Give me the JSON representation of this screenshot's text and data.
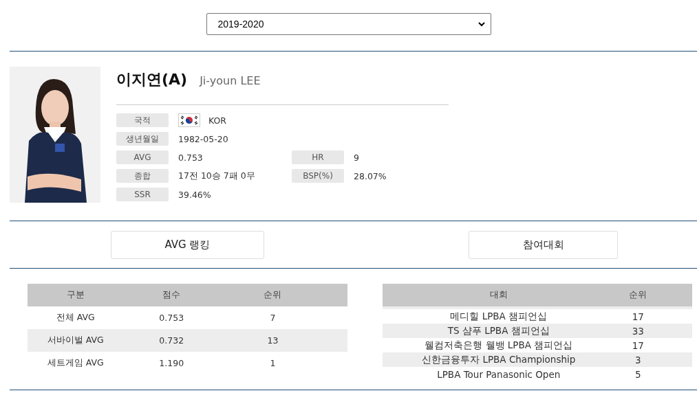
{
  "season_select": {
    "value": "2019-2020"
  },
  "player": {
    "name_ko": "이지연(A)",
    "name_en": "Ji-youn LEE",
    "info_rows": [
      {
        "label": "국적",
        "value": "KOR",
        "kind": "flag"
      },
      {
        "label": "생년월일",
        "value": "1982-05-20",
        "kind": "text"
      },
      {
        "label": "AVG",
        "value": "0.753",
        "label2": "HR",
        "value2": "9",
        "kind": "text"
      },
      {
        "label": "종합",
        "value": "17전 10승 7패 0무",
        "label2": "BSP(%)",
        "value2": "28.07%",
        "kind": "text"
      },
      {
        "label": "SSR",
        "value": "39.46%",
        "kind": "text"
      }
    ]
  },
  "buttons": [
    {
      "label": "AVG 랭킹"
    },
    {
      "label": "참여대회"
    }
  ],
  "avg_table": {
    "columns": [
      "구분",
      "점수",
      "순위"
    ],
    "rows": [
      [
        "전체 AVG",
        "0.753",
        "7"
      ],
      [
        "서바이벌 AVG",
        "0.732",
        "13"
      ],
      [
        "세트게임 AVG",
        "1.190",
        "1"
      ]
    ]
  },
  "tournament_table": {
    "columns": [
      "대회",
      "순위"
    ],
    "rows": [
      [
        "메디힐 LPBA 챔피언십",
        "17"
      ],
      [
        "TS 샴푸 LPBA 챔피언십",
        "33"
      ],
      [
        "웰컴저축은행 웰뱅 LPBA 챔피언십",
        "17"
      ],
      [
        "신한금융투자 LPBA Championship",
        "3"
      ],
      [
        "LPBA Tour Panasonic Open",
        "5"
      ]
    ]
  }
}
